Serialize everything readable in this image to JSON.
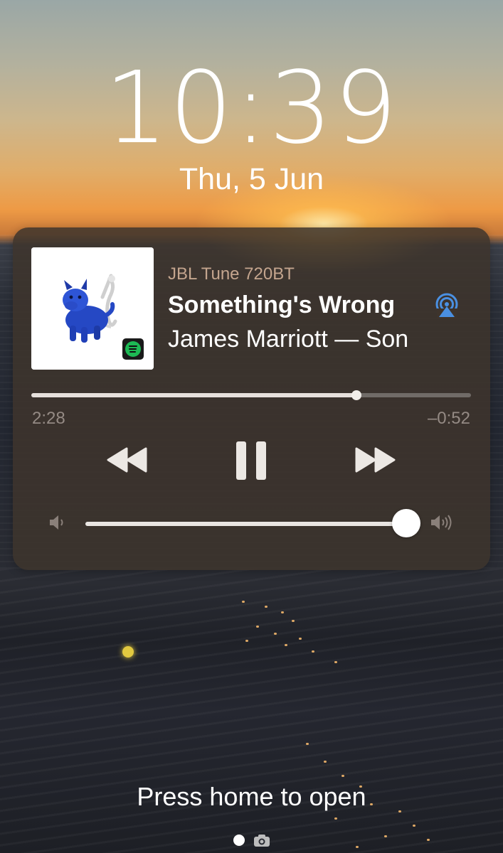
{
  "lockscreen": {
    "time": "10:39",
    "date": "Thu, 5 Jun",
    "unlock_hint": "Press home to open",
    "page_indicator": [
      "page-dot",
      "camera-icon"
    ]
  },
  "now_playing": {
    "output_device": "JBL Tune 720BT",
    "track_title": "Something's Wrong",
    "subtitle": "James Marriott — Son",
    "artwork": "blue-dog-figurine",
    "source_app_icon": "spotify-icon",
    "route_icon": "airplay-icon",
    "elapsed": "2:28",
    "remaining": "–0:52",
    "progress_fraction": 0.74,
    "volume_fraction": 0.96,
    "controls": {
      "rewind": "rewind-icon",
      "play_pause": "pause-icon",
      "forward": "fast-forward-icon",
      "volume_low": "speaker-low-icon",
      "volume_high": "speaker-high-icon"
    }
  },
  "colors": {
    "card_background": "#3e342c",
    "device_text": "#c4a58e",
    "time_labels": "#948a84",
    "airplay_accent": "#4a90e2",
    "spotify_green": "#1db954"
  }
}
